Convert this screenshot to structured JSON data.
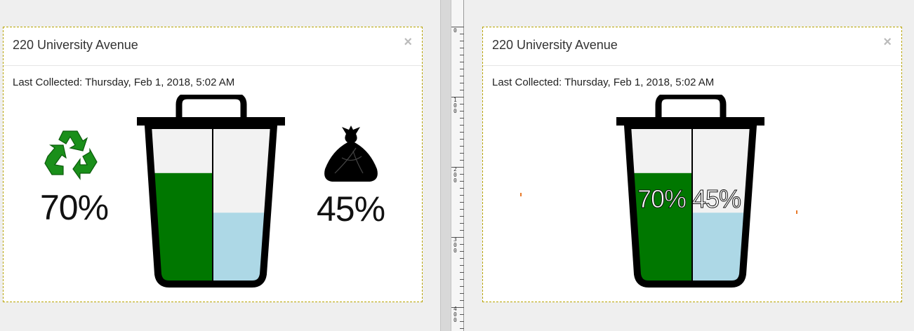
{
  "left_panel": {
    "title": "220 University Avenue",
    "close": "×",
    "last_collected": "Last Collected: Thursday, Feb 1, 2018, 5:02 AM",
    "recycle_percent": "70%",
    "trash_percent": "45%",
    "recycle_level": 0.7,
    "trash_level": 0.45
  },
  "right_panel": {
    "title": "220 University Avenue",
    "close": "×",
    "last_collected": "Last Collected: Thursday, Feb 1, 2018, 5:02 AM",
    "recycle_percent": "70%",
    "trash_percent": "45%",
    "recycle_level": 0.7,
    "trash_level": 0.45
  },
  "ruler": {
    "labels": [
      "0",
      "100",
      "200",
      "300",
      "400"
    ]
  },
  "colors": {
    "recycle_fill": "#007700",
    "trash_fill": "#add8e6",
    "bin_empty": "#f2f2f2",
    "bin_outline": "#000000",
    "recycle_icon": "#1a8f1a"
  },
  "icons": {
    "recycle": "recycle-icon",
    "trash_bag": "trash-bag-icon",
    "close": "close-icon"
  }
}
